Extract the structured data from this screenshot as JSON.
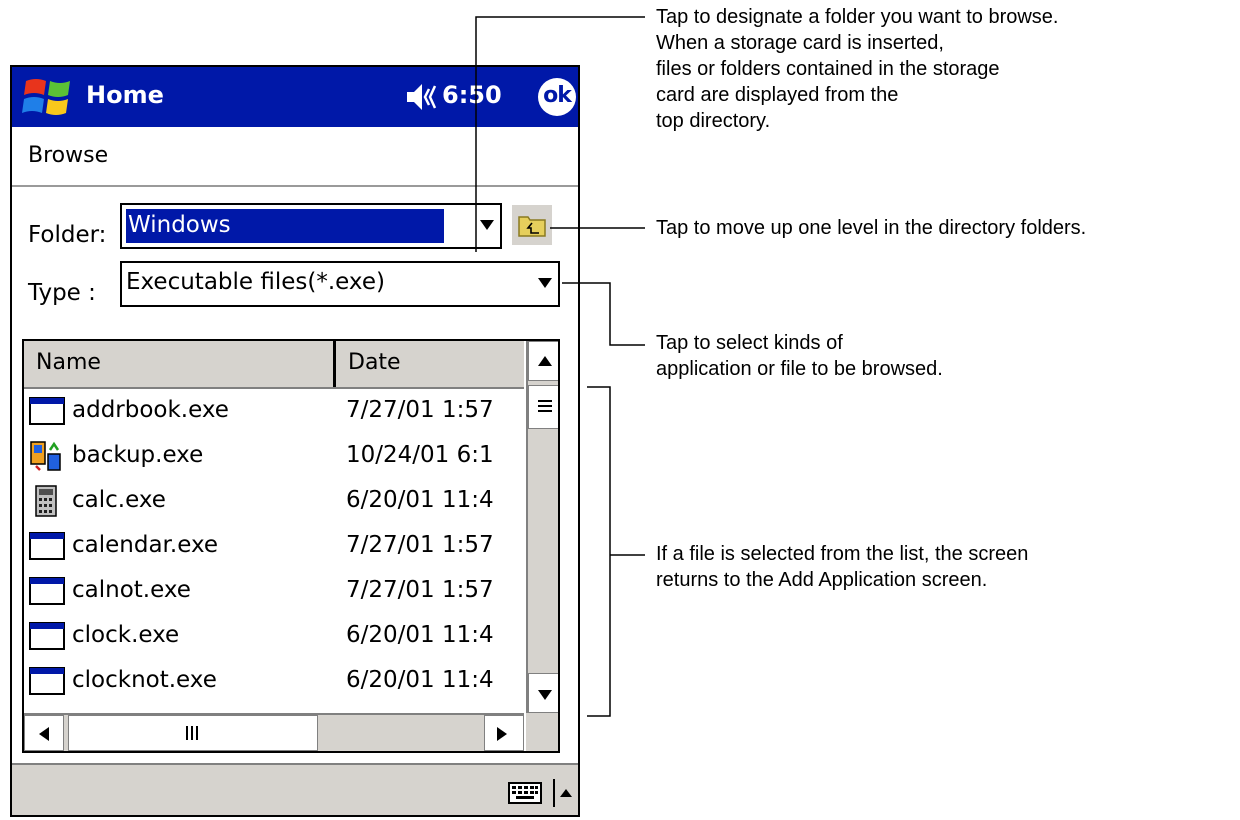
{
  "titlebar": {
    "title": "Home",
    "time": "6:50",
    "ok_label": "ok",
    "color": "#0018a8"
  },
  "subtitle": "Browse",
  "folder": {
    "label": "Folder:",
    "value": "Windows"
  },
  "type": {
    "label": "Type :",
    "value": "Executable files(*.exe)"
  },
  "list": {
    "headers": {
      "name": "Name",
      "date": "Date"
    },
    "rows": [
      {
        "name": "addrbook.exe",
        "date": "7/27/01 1:57",
        "icon": "window-icon"
      },
      {
        "name": "backup.exe",
        "date": "10/24/01 6:1",
        "icon": "backup-icon"
      },
      {
        "name": "calc.exe",
        "date": "6/20/01 11:4",
        "icon": "calculator-icon"
      },
      {
        "name": "calendar.exe",
        "date": "7/27/01 1:57",
        "icon": "window-icon"
      },
      {
        "name": "calnot.exe",
        "date": "7/27/01 1:57",
        "icon": "window-icon"
      },
      {
        "name": "clock.exe",
        "date": "6/20/01 11:4",
        "icon": "window-icon"
      },
      {
        "name": "clocknot.exe",
        "date": "6/20/01 11:4",
        "icon": "window-icon"
      }
    ]
  },
  "callouts": [
    {
      "lines": [
        "Tap to designate a folder you want to browse.",
        "When a storage card is inserted,",
        "files or folders contained in the storage",
        "card are displayed from the",
        "top directory."
      ]
    },
    {
      "lines": [
        "Tap to move up one level in the directory folders."
      ]
    },
    {
      "lines": [
        "Tap to select kinds of",
        "application or file to be browsed."
      ]
    },
    {
      "lines": [
        "If a file is selected from the list, the screen",
        "returns to the Add Application screen."
      ]
    }
  ]
}
